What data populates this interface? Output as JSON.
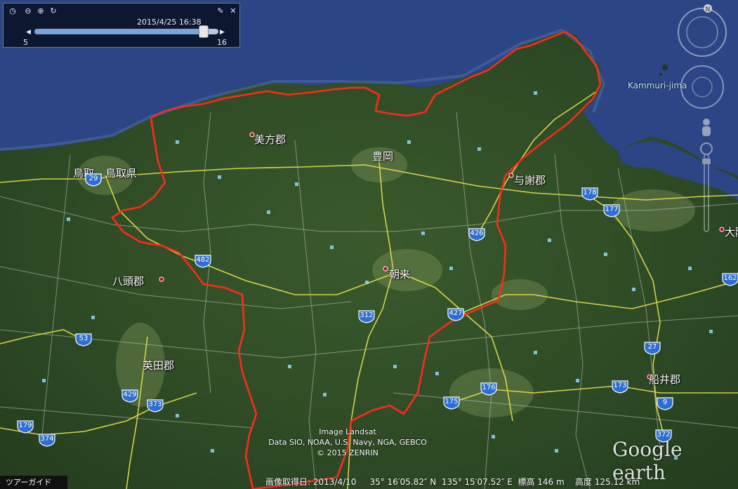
{
  "time_slider": {
    "timestamp": "2015/4/25  16:38",
    "min_label": "5",
    "max_label": "16",
    "position": 0.92
  },
  "places": {
    "tottori_city": "鳥取",
    "tottori_pref": "鳥取県",
    "mikata": "美方郡",
    "toyooka": "豊岡",
    "yosa": "与謝郡",
    "yazu": "八頭郡",
    "asago": "朝来",
    "aida": "英田郡",
    "funai": "船井郡",
    "osaka_partial": "大阪",
    "island": "Kammuri-jima"
  },
  "route_shields": [
    {
      "id": "r29",
      "label": "29"
    },
    {
      "id": "r482",
      "label": "482"
    },
    {
      "id": "r178",
      "label": "178"
    },
    {
      "id": "r177",
      "label": "177"
    },
    {
      "id": "r426",
      "label": "426"
    },
    {
      "id": "r427",
      "label": "427"
    },
    {
      "id": "r312",
      "label": "312"
    },
    {
      "id": "r53",
      "label": "53"
    },
    {
      "id": "r162",
      "label": "162"
    },
    {
      "id": "r27",
      "label": "27"
    },
    {
      "id": "r176",
      "label": "176"
    },
    {
      "id": "r173",
      "label": "173"
    },
    {
      "id": "r9",
      "label": "9"
    },
    {
      "id": "r429",
      "label": "429"
    },
    {
      "id": "r373",
      "label": "373"
    },
    {
      "id": "r175",
      "label": "175"
    },
    {
      "id": "r179",
      "label": "179"
    },
    {
      "id": "r374",
      "label": "374"
    },
    {
      "id": "r372",
      "label": "372"
    }
  ],
  "credits": {
    "line1": "Image Landsat",
    "line2": "Data SIO, NOAA, U.S. Navy, NGA, GEBCO",
    "line3": "© 2015 ZENRIN"
  },
  "logo": "Google earth",
  "tour_guide": "ツアーガイド",
  "status": {
    "image_date": "画像取得日: 2013/4/10",
    "lat": "35°  16′05.82″ N",
    "lon": "135°  15′07.52″ E",
    "elev": "標高   146 m",
    "alt": "高度 125.12 km"
  },
  "nav": {
    "north_label": "N"
  },
  "colors": {
    "sea": "#2b4585",
    "land": "#2d4a24",
    "border": "#ff2a1a",
    "road_major": "#e8e04a",
    "road_minor": "#c8c8c8"
  }
}
